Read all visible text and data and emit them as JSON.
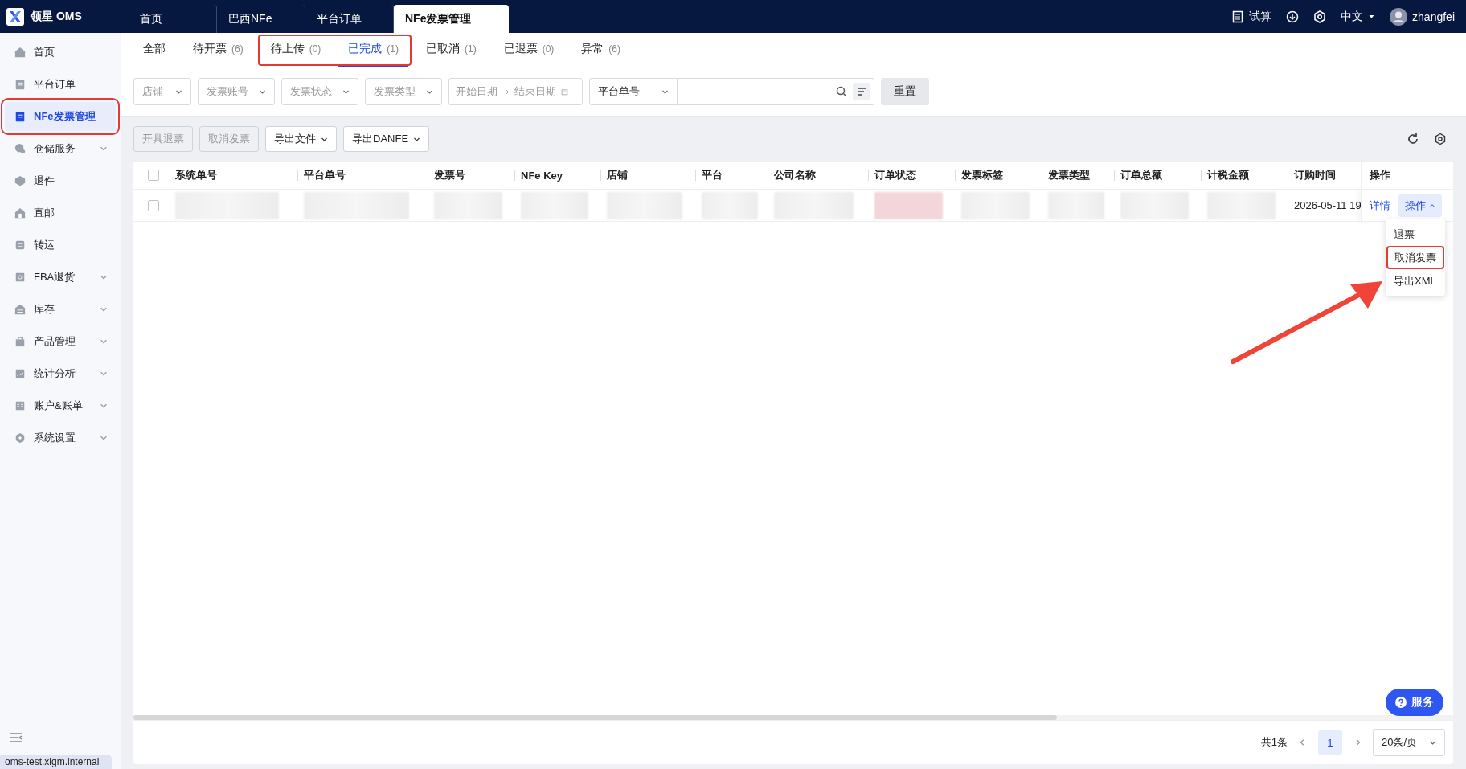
{
  "app": {
    "name": "领星 OMS"
  },
  "top_tabs": [
    {
      "label": "首页",
      "selected": false
    },
    {
      "label": "巴西NFe",
      "selected": false
    },
    {
      "label": "平台订单",
      "selected": false
    },
    {
      "label": "NFe发票管理",
      "selected": true
    }
  ],
  "top_right": {
    "trial": "试算",
    "language": "中文",
    "user": "zhangfei"
  },
  "sidebar": {
    "items": [
      {
        "label": "首页",
        "selected": false,
        "expandable": false,
        "highlighted": false
      },
      {
        "label": "平台订单",
        "selected": false,
        "expandable": false,
        "highlighted": false
      },
      {
        "label": "NFe发票管理",
        "selected": true,
        "expandable": false,
        "highlighted": true
      },
      {
        "label": "仓储服务",
        "selected": false,
        "expandable": true,
        "highlighted": false
      },
      {
        "label": "退件",
        "selected": false,
        "expandable": false,
        "highlighted": false
      },
      {
        "label": "直邮",
        "selected": false,
        "expandable": false,
        "highlighted": false
      },
      {
        "label": "转运",
        "selected": false,
        "expandable": false,
        "highlighted": false
      },
      {
        "label": "FBA退货",
        "selected": false,
        "expandable": true,
        "highlighted": false
      },
      {
        "label": "库存",
        "selected": false,
        "expandable": true,
        "highlighted": false
      },
      {
        "label": "产品管理",
        "selected": false,
        "expandable": true,
        "highlighted": false
      },
      {
        "label": "统计分析",
        "selected": false,
        "expandable": true,
        "highlighted": false
      },
      {
        "label": "账户&账单",
        "selected": false,
        "expandable": true,
        "highlighted": false
      },
      {
        "label": "系统设置",
        "selected": false,
        "expandable": true,
        "highlighted": false
      }
    ],
    "host": "oms-test.xlgm.internal"
  },
  "status_tabs": [
    {
      "label": "全部",
      "selected": false,
      "highlighted": false
    },
    {
      "label": "待开票",
      "count": "(6)",
      "selected": false,
      "highlighted": false
    },
    {
      "label": "待上传",
      "count": "(0)",
      "selected": false,
      "highlighted": true
    },
    {
      "label": "已完成",
      "count": "(1)",
      "selected": true,
      "highlighted": true
    },
    {
      "label": "已取消",
      "count": "(1)",
      "selected": false,
      "highlighted": false
    },
    {
      "label": "已退票",
      "count": "(0)",
      "selected": false,
      "highlighted": false
    },
    {
      "label": "异常",
      "count": "(6)",
      "selected": false,
      "highlighted": false
    }
  ],
  "filters": {
    "selects": [
      {
        "placeholder": "店铺"
      },
      {
        "placeholder": "发票账号"
      },
      {
        "placeholder": "发票状态"
      },
      {
        "placeholder": "发票类型"
      }
    ],
    "date_range": {
      "start_placeholder": "开始日期",
      "end_placeholder": "结束日期"
    },
    "search_type": "平台单号",
    "reset": "重置"
  },
  "toolbar": {
    "buttons": [
      {
        "label": "开具退票",
        "disabled": true,
        "dropdown": false
      },
      {
        "label": "取消发票",
        "disabled": true,
        "dropdown": false
      },
      {
        "label": "导出文件",
        "disabled": false,
        "dropdown": true
      },
      {
        "label": "导出DANFE",
        "disabled": false,
        "dropdown": true
      }
    ]
  },
  "table": {
    "select_all": {
      "checked": false
    },
    "columns": [
      "系统单号",
      "平台单号",
      "发票号",
      "NFe Key",
      "店铺",
      "平台",
      "公司名称",
      "订单状态",
      "发票标签",
      "发票类型",
      "订单总额",
      "计税金额",
      "订购时间",
      "操作"
    ],
    "rows": [
      {
        "checked": false,
        "cells": [
          {
            "kind": "blurred"
          },
          {
            "kind": "blurred"
          },
          {
            "kind": "blurred"
          },
          {
            "kind": "blurred"
          },
          {
            "kind": "blurred"
          },
          {
            "kind": "blurred"
          },
          {
            "kind": "blurred"
          },
          {
            "kind": "blurred",
            "color": "#f3d6da"
          },
          {
            "kind": "blurred"
          },
          {
            "kind": "blurred"
          },
          {
            "kind": "blurred"
          },
          {
            "kind": "blurred"
          },
          {
            "kind": "text",
            "text": "2026-05-11 19"
          }
        ],
        "detail_link": "详情",
        "action_button": {
          "label": "操作",
          "expanded": true
        }
      }
    ]
  },
  "action_menu": {
    "items": [
      {
        "label": "退票",
        "highlighted": false
      },
      {
        "label": "取消发票",
        "highlighted": true
      },
      {
        "label": "导出XML",
        "highlighted": false
      }
    ]
  },
  "pointer_arrow": true,
  "pagination": {
    "total": "共1条",
    "pages": [
      {
        "label": "1",
        "selected": true
      }
    ],
    "page_size": "20条/页"
  },
  "service_button": "服务"
}
